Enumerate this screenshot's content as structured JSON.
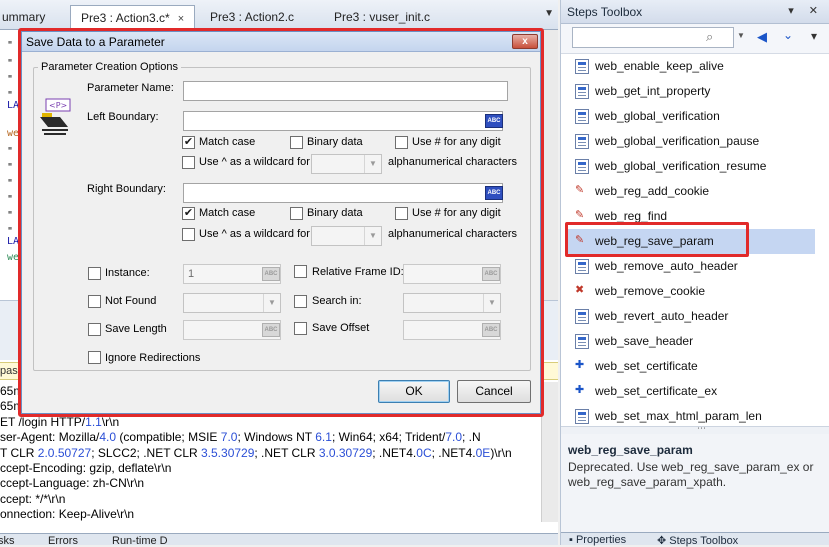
{
  "editor": {
    "tabs": [
      {
        "label": "ummary",
        "active": false
      },
      {
        "label": "Pre3 : Action3.c*",
        "active": true
      },
      {
        "label": "Pre3 : Action2.c",
        "active": false
      },
      {
        "label": "Pre3 : vuser_init.c",
        "active": false
      }
    ],
    "tab_close": "×",
    "gutter_chars": [
      "\"",
      "\"",
      "\"",
      "\"",
      "LA",
      "we",
      "\"",
      "\"",
      "\"",
      "\"",
      "\"",
      "\"",
      "LA",
      "we"
    ],
    "strip_text": "pas",
    "log_lines": [
      {
        "parts": [
          {
            "t": "65ms",
            "c": ""
          }
        ]
      },
      {
        "parts": [
          {
            "t": "65ms",
            "c": ""
          }
        ]
      },
      {
        "parts": [
          {
            "t": "ET /login HTTP/",
            "c": ""
          },
          {
            "t": "1.1",
            "c": "blue"
          },
          {
            "t": "\\r\\n",
            "c": ""
          }
        ]
      },
      {
        "parts": [
          {
            "t": "ser-Agent: Mozilla/",
            "c": ""
          },
          {
            "t": "4.0",
            "c": "blue"
          },
          {
            "t": " (compatible; MSIE ",
            "c": ""
          },
          {
            "t": "7.0",
            "c": "blue"
          },
          {
            "t": "; Windows NT ",
            "c": ""
          },
          {
            "t": "6.1",
            "c": "blue"
          },
          {
            "t": "; Win64; x64; Trident/",
            "c": ""
          },
          {
            "t": "7.0",
            "c": "blue"
          },
          {
            "t": "; .N",
            "c": ""
          }
        ]
      },
      {
        "parts": [
          {
            "t": "T CLR ",
            "c": ""
          },
          {
            "t": "2.0.50727",
            "c": "blue"
          },
          {
            "t": "; SLCC2; .NET CLR ",
            "c": ""
          },
          {
            "t": "3.5.30729",
            "c": "blue"
          },
          {
            "t": "; .NET CLR ",
            "c": ""
          },
          {
            "t": "3.0.30729",
            "c": "blue"
          },
          {
            "t": "; .NET4.",
            "c": ""
          },
          {
            "t": "0C",
            "c": "blue"
          },
          {
            "t": "; .NET4.",
            "c": ""
          },
          {
            "t": "0E",
            "c": "blue"
          },
          {
            "t": ")\\r\\n",
            "c": ""
          }
        ]
      },
      {
        "parts": [
          {
            "t": "ccept-Encoding: gzip, deflate\\r\\n",
            "c": ""
          }
        ]
      },
      {
        "parts": [
          {
            "t": "ccept-Language: zh-CN\\r\\n",
            "c": ""
          }
        ]
      },
      {
        "parts": [
          {
            "t": "ccept: */*\\r\\n",
            "c": ""
          }
        ]
      },
      {
        "parts": [
          {
            "t": "onnection: Keep-Alive\\r\\n",
            "c": ""
          }
        ]
      }
    ],
    "bottom_tabs": [
      "sks",
      "Errors",
      "Run-time D"
    ]
  },
  "toolbox": {
    "title": "Steps Toolbox",
    "header_icons": "▾ ✕",
    "search_placeholder": "",
    "items": [
      {
        "label": "web_enable_keep_alive",
        "icon": "page"
      },
      {
        "label": "web_get_int_property",
        "icon": "page"
      },
      {
        "label": "web_global_verification",
        "icon": "page"
      },
      {
        "label": "web_global_verification_pause",
        "icon": "page"
      },
      {
        "label": "web_global_verification_resume",
        "icon": "page"
      },
      {
        "label": "web_reg_add_cookie",
        "icon": "reg"
      },
      {
        "label": "web_reg_find",
        "icon": "reg"
      },
      {
        "label": "web_reg_save_param",
        "icon": "reg",
        "selected": true
      },
      {
        "label": "web_remove_auto_header",
        "icon": "page"
      },
      {
        "label": "web_remove_cookie",
        "icon": "cookie"
      },
      {
        "label": "web_revert_auto_header",
        "icon": "page"
      },
      {
        "label": "web_save_header",
        "icon": "page"
      },
      {
        "label": "web_set_certificate",
        "icon": "cert"
      },
      {
        "label": "web_set_certificate_ex",
        "icon": "cert"
      },
      {
        "label": "web_set_max_html_param_len",
        "icon": "page"
      }
    ],
    "desc_title": "web_reg_save_param",
    "desc_text": "Deprecated. Use web_reg_save_param_ex or web_reg_save_param_xpath.",
    "bottom_tabs": [
      "Properties",
      "Steps Toolbox"
    ]
  },
  "dialog": {
    "title": "Save Data to a Parameter",
    "close_label": "x",
    "group_label": "Parameter Creation Options",
    "icon_text": "<P>",
    "param_name_label": "Parameter Name:",
    "param_name_value": "",
    "left_boundary_label": "Left Boundary:",
    "left_boundary_value": "",
    "right_boundary_label": "Right Boundary:",
    "right_boundary_value": "",
    "abc": "ABC",
    "match_case": "Match case",
    "binary_data": "Binary data",
    "use_hash": "Use # for any digit",
    "use_caret": "Use ^ as a wildcard for",
    "alnum": "alphanumerical characters",
    "left": {
      "match_case": true,
      "binary_data": false,
      "use_hash": false,
      "use_caret": false
    },
    "right": {
      "match_case": true,
      "binary_data": false,
      "use_hash": false,
      "use_caret": false
    },
    "instance_label": "Instance:",
    "instance_value": "1",
    "relative_frame_label": "Relative Frame ID:",
    "not_found_label": "Not Found",
    "search_in_label": "Search in:",
    "save_length_label": "Save Length",
    "save_offset_label": "Save Offset",
    "ignore_redirections_label": "Ignore Redirections",
    "ok_label": "OK",
    "cancel_label": "Cancel",
    "check_mark": "✔"
  }
}
